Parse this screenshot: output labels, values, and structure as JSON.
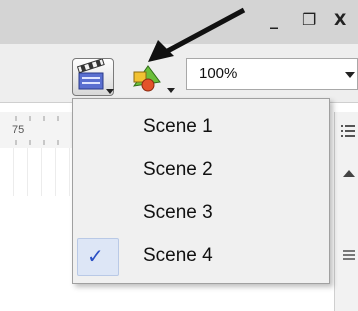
{
  "window": {
    "minimize_glyph": "_",
    "restore_glyph": "❐",
    "close_glyph": "X"
  },
  "toolbar": {
    "scene_button_icon": "clapperboard-icon",
    "symbol_button_icon": "shapes-icon",
    "zoom_value": "100%"
  },
  "ruler": {
    "label": "75"
  },
  "scene_menu": {
    "items": [
      {
        "label": "Scene 1",
        "checked": false
      },
      {
        "label": "Scene 2",
        "checked": false
      },
      {
        "label": "Scene 3",
        "checked": false
      },
      {
        "label": "Scene 4",
        "checked": true
      }
    ],
    "check_glyph": "✓"
  },
  "colors": {
    "accent": "#2a4fc4",
    "arrow": "#111111",
    "titlebar": "#d4d4d4"
  }
}
